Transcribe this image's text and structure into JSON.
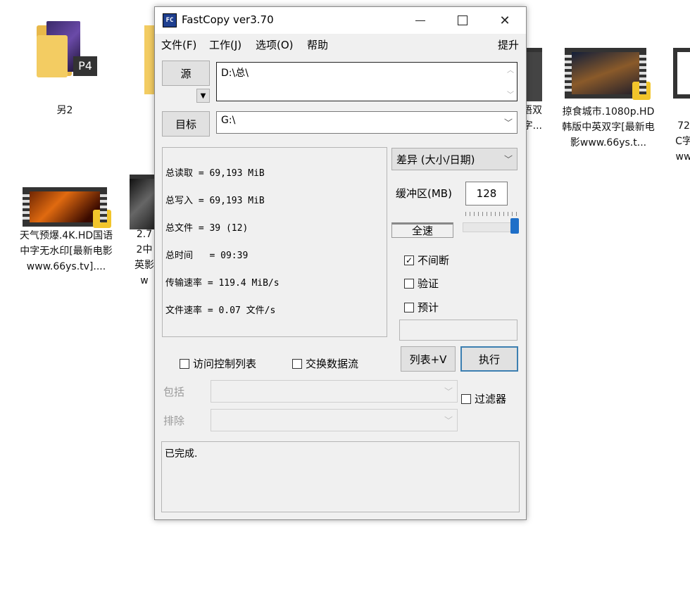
{
  "desktop": {
    "icons": [
      {
        "label": "另2"
      },
      {
        "label": "天气预爆.4K.HD国语中字无水印[最新电影www.66ys.tv]...."
      },
      {
        "label": "2.72中英影w"
      },
      {
        "label": ".国语双字..."
      },
      {
        "label": "掠食城市.1080p.HD韩版中英双字[最新电影www.66ys.t..."
      },
      {
        "label": "72C字ww"
      }
    ],
    "badge_text": "P4"
  },
  "window": {
    "title": "FastCopy ver3.70",
    "app_icon_text": "FC",
    "controls": {
      "minimize": "minimize-icon",
      "maximize": "maximize-icon",
      "close": "close-icon"
    },
    "menu": [
      "文件(F)",
      "工作(J)",
      "选项(O)",
      "帮助"
    ],
    "menu_extra": "提升",
    "source_button": "源",
    "source_value": "D:\\总\\",
    "target_button": "目标",
    "target_value": "G:\\",
    "stats": [
      "总读取 = 69,193 MiB",
      "总写入 = 69,193 MiB",
      "总文件 = 39 (12)",
      "总时间   = 09:39",
      "传输速率 = 119.4 MiB/s",
      "文件速率 = 0.07 文件/s"
    ],
    "mode_select": "差异 (大小/日期)",
    "buffer_label": "缓冲区(MB)",
    "buffer_value": "128",
    "speed_label": "全速",
    "speed_level": 1.0,
    "checkboxes": [
      {
        "label": "不间断",
        "checked": true
      },
      {
        "label": "验证",
        "checked": false
      },
      {
        "label": "预计",
        "checked": false
      }
    ],
    "acl_label": "访问控制列表",
    "stream_label": "交换数据流",
    "list_button": "列表+V",
    "execute_button": "执行",
    "include_label": "包括",
    "exclude_label": "排除",
    "filter_label": "过滤器",
    "status_text": "已完成."
  }
}
